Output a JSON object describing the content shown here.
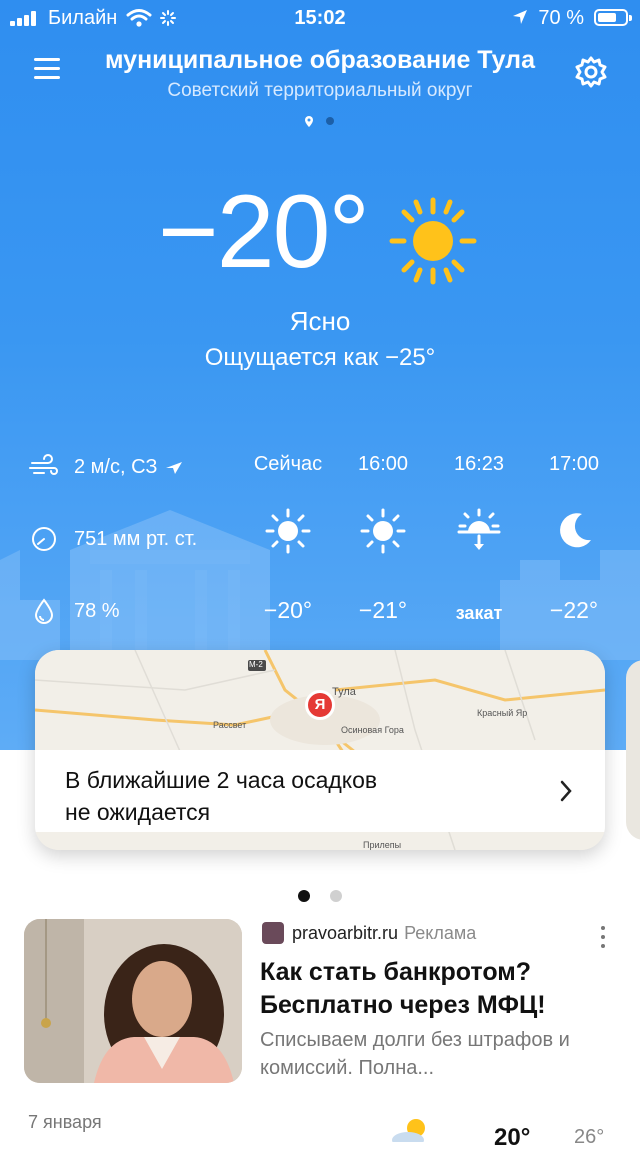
{
  "status_bar": {
    "carrier": "Билайн",
    "time": "15:02",
    "battery": "70 %",
    "battery_level": 0.7
  },
  "header": {
    "title": "муниципальное образование Тула",
    "subtitle": "Советский территориальный округ"
  },
  "current": {
    "temperature": "−20°",
    "condition": "Ясно",
    "feels_like": "Ощущается как −25°"
  },
  "metrics": {
    "wind": "2 м/с, СЗ",
    "pressure": "751 мм рт. ст.",
    "humidity": "78 %"
  },
  "hourly": [
    {
      "label": "Сейчас",
      "icon": "sun-icon",
      "temp": "−20°"
    },
    {
      "label": "16:00",
      "icon": "sun-icon",
      "temp": "−21°"
    },
    {
      "label": "16:23",
      "icon": "sunset-icon",
      "temp": "закат"
    },
    {
      "label": "17:00",
      "icon": "moon-icon",
      "temp": "−22°"
    }
  ],
  "map_card": {
    "message_line1": "В ближайшие 2 часа осадков",
    "message_line2": "не ожидается",
    "map_labels": {
      "road": "М-2",
      "city": "Тула",
      "rassvet": "Рассвет",
      "osinovaya": "Осиновая Гора",
      "krasny": "Красный Яр",
      "prilepy": "Прилепы",
      "marker": "Я"
    }
  },
  "carousel": {
    "count": 2,
    "active": 0
  },
  "ad": {
    "source": "pravoarbitr.ru",
    "tag": "Реклама",
    "title": "Как стать банкротом? Бесплатно через МФЦ!",
    "description": "Списываем долги без штрафов и комиссий. Полна..."
  },
  "daily_preview": {
    "date": "7 января",
    "icon": "partly-cloudy-icon",
    "max": "20°",
    "min": "26°"
  },
  "colors": {
    "sky_top": "#2f8ef0",
    "sun": "#ffc21a",
    "map_marker": "#e53935"
  }
}
